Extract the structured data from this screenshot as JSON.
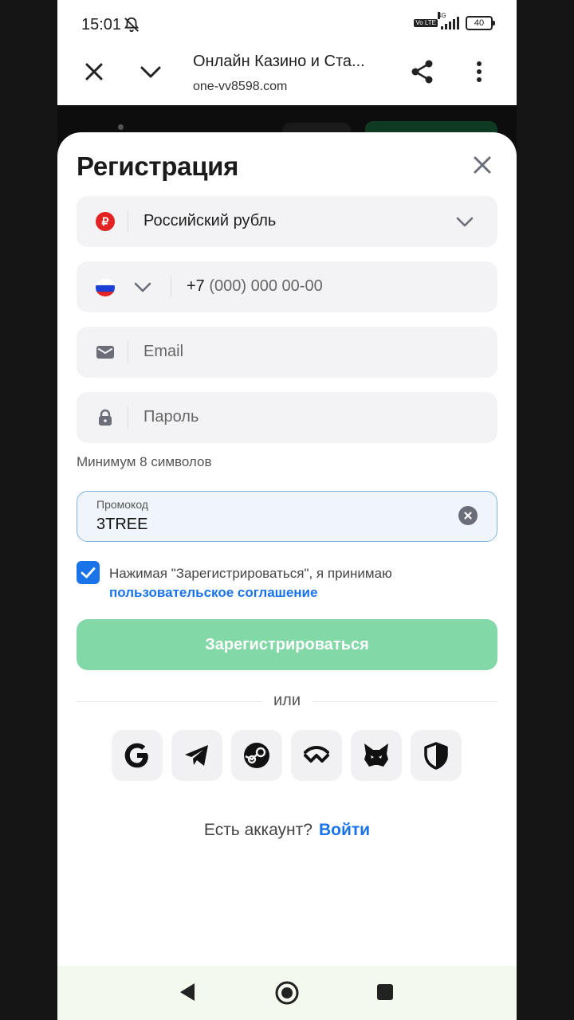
{
  "statusbar": {
    "time": "15:01",
    "volte": "Vo LTE",
    "network": "4G",
    "battery": "40"
  },
  "browser": {
    "title": "Онлайн Казино и Ста...",
    "url": "one-vv8598.com"
  },
  "sheet": {
    "title": "Регистрация",
    "currency": {
      "symbol": "₽",
      "label": "Российский рубль"
    },
    "phone": {
      "prefix": "+7",
      "placeholder": "(000) 000 00-00"
    },
    "email": {
      "placeholder": "Email"
    },
    "password": {
      "placeholder": "Пароль",
      "hint": "Минимум 8 символов"
    },
    "promo": {
      "label": "Промокод",
      "value": "3TREE"
    },
    "agreement": {
      "text": "Нажимая \"Зарегистрироваться\", я принимаю",
      "link": "пользовательское соглашение",
      "checked": true
    },
    "submit_label": "Зарегистрироваться",
    "or_label": "или",
    "socials": [
      "google-icon",
      "telegram-icon",
      "steam-icon",
      "walletconnect-icon",
      "metamask-fox-icon",
      "shield-icon"
    ],
    "have_account": "Есть аккаунт?",
    "login_label": "Войти"
  },
  "colors": {
    "accent": "#1a73e8",
    "submit_disabled": "#82d8a6",
    "field_bg": "#f3f3f5",
    "ruble_red": "#e32222"
  }
}
